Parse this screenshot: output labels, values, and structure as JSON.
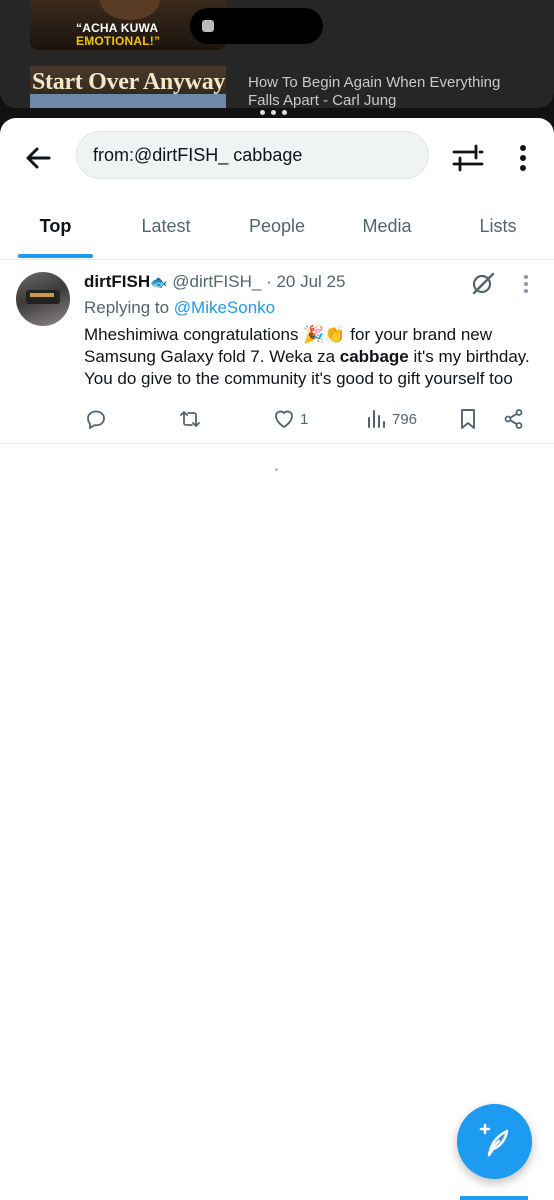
{
  "background_video": {
    "thumb1_caption_line1": "“ACHA KUWA",
    "thumb1_caption_line2": "EMOTIONAL!”",
    "thumb2_title": "Start Over Anyway",
    "video_title": "How To Begin Again When Everything Falls Apart - Carl Jung"
  },
  "search": {
    "query": "from:@dirtFISH_ cabbage"
  },
  "tabs": [
    {
      "label": "Top",
      "active": true
    },
    {
      "label": "Latest",
      "active": false
    },
    {
      "label": "People",
      "active": false
    },
    {
      "label": "Media",
      "active": false
    },
    {
      "label": "Lists",
      "active": false
    }
  ],
  "tweet": {
    "display_name": "dirtFISH",
    "name_emoji": "🐟",
    "handle": "@dirtFISH_",
    "date": "· 20 Jul 25",
    "replying_to_prefix": "Replying to ",
    "replying_to_handle": "@MikeSonko",
    "text_part1": "Mheshimiwa congratulations 🎉👏 for your brand new Samsung Galaxy fold 7. Weka za ",
    "text_bold": "cabbage",
    "text_part2": " it's my birthday. You do give to the community it's good to gift yourself too",
    "likes": "1",
    "views": "796"
  },
  "colors": {
    "accent": "#1d9bf0",
    "text_primary": "#0f1419",
    "text_secondary": "#536471"
  }
}
